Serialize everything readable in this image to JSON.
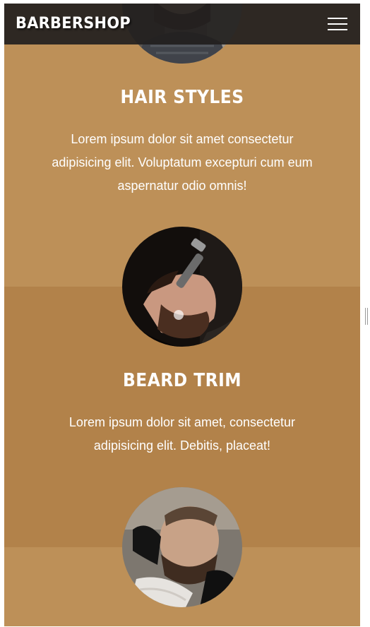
{
  "header": {
    "brand": "BARBERSHOP",
    "menu_icon": "hamburger-menu-icon"
  },
  "services": [
    {
      "title": "HAIR STYLES",
      "description": "Lorem ipsum dolor sit amet consectetur adipisicing elit. Voluptatum excepturi cum eum aspernatur odio omnis!",
      "image": "barber-cutting-hair-photo"
    },
    {
      "title": "BEARD TRIM",
      "description": "Lorem ipsum dolor sit amet, consectetur adipisicing elit. Debitis, placeat!",
      "image": "beard-trimming-photo"
    },
    {
      "title": "",
      "description": "",
      "image": "face-shave-photo"
    }
  ],
  "colors": {
    "section_light": "#bd9058",
    "section_dark": "#b2824a",
    "navbar": "#221f1e",
    "text": "#ffffff"
  }
}
